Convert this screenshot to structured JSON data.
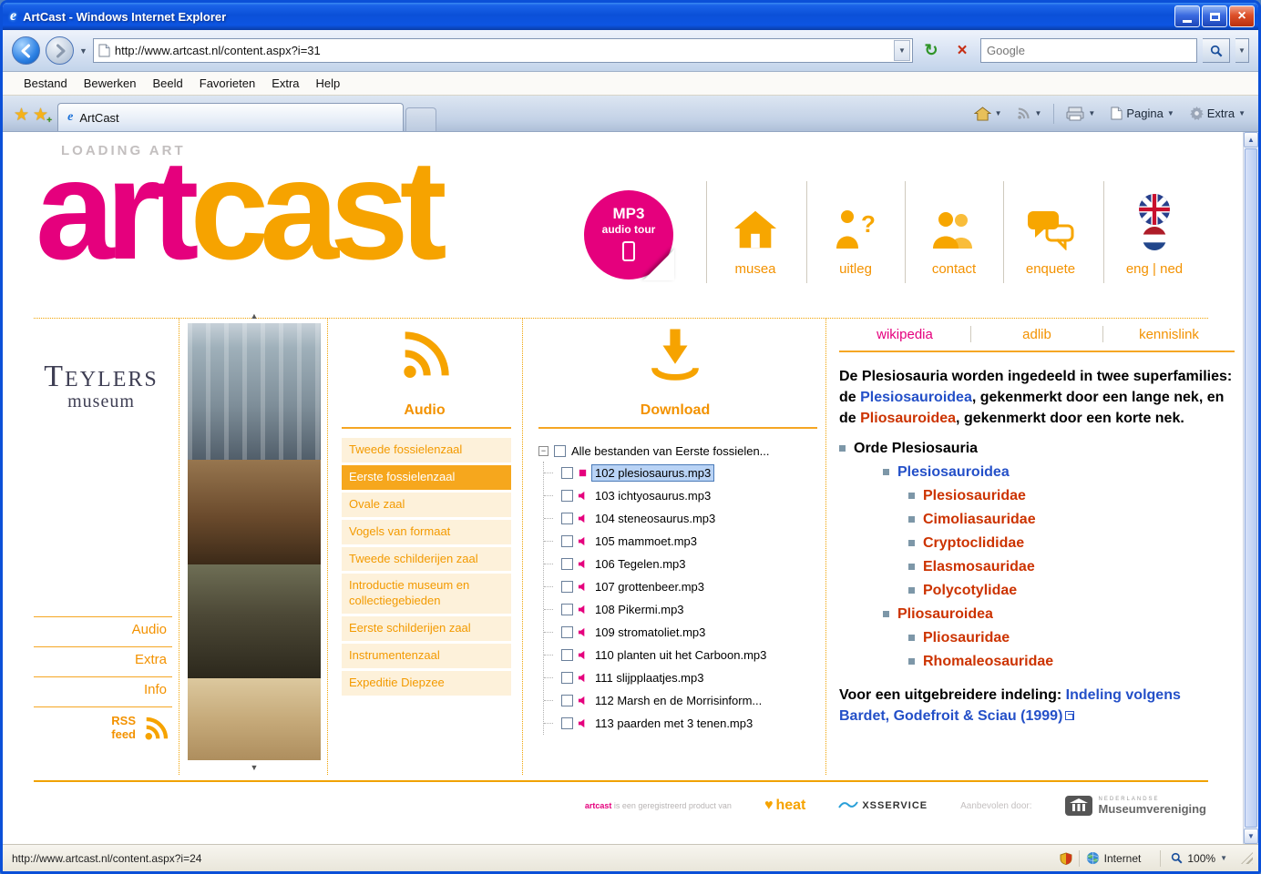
{
  "colors": {
    "brand_pink": "#e5007d",
    "brand_orange": "#f6a300",
    "link_blue": "#2450c8",
    "taxon_red": "#cc3300",
    "xp_titlebar_blue": "#0b50d8"
  },
  "window": {
    "title": "ArtCast - Windows Internet Explorer"
  },
  "address_bar": {
    "url": "http://www.artcast.nl/content.aspx?i=31",
    "search_placeholder": "Google"
  },
  "menu": {
    "items": [
      "Bestand",
      "Bewerken",
      "Beeld",
      "Favorieten",
      "Extra",
      "Help"
    ]
  },
  "tab_bar": {
    "active_tab": "ArtCast",
    "pagina_label": "Pagina",
    "extra_label": "Extra"
  },
  "header": {
    "loading": "LOADING ART",
    "logo_art": "art",
    "logo_cast": "cast",
    "badge_line1": "MP3",
    "badge_line2": "audio tour",
    "nav": [
      {
        "label": "musea"
      },
      {
        "label": "uitleg"
      },
      {
        "label": "contact"
      },
      {
        "label": "enquete"
      }
    ],
    "lang": "eng | ned"
  },
  "sidebar": {
    "museum_name": "Teylers",
    "museum_sub": "museum",
    "links": [
      "Audio",
      "Extra",
      "Info"
    ],
    "rss_line1": "RSS",
    "rss_line2": "feed"
  },
  "audio_panel": {
    "title": "Audio",
    "items": [
      {
        "label": "Tweede fossielenzaal",
        "selected": false
      },
      {
        "label": "Eerste fossielenzaal",
        "selected": true
      },
      {
        "label": "Ovale zaal",
        "selected": false
      },
      {
        "label": "Vogels van formaat",
        "selected": false
      },
      {
        "label": "Tweede schilderijen zaal",
        "selected": false
      },
      {
        "label": "Introductie museum en collectiegebieden",
        "selected": false
      },
      {
        "label": "Eerste schilderijen zaal",
        "selected": false
      },
      {
        "label": "Instrumentenzaal",
        "selected": false
      },
      {
        "label": "Expeditie Diepzee",
        "selected": false
      }
    ]
  },
  "download_panel": {
    "title": "Download",
    "root_label": "Alle bestanden van Eerste fossielen...",
    "files": [
      {
        "label": "102 plesiosaurus.mp3",
        "selected": true
      },
      {
        "label": "103 ichtyosaurus.mp3",
        "selected": false
      },
      {
        "label": "104 steneosaurus.mp3",
        "selected": false
      },
      {
        "label": "105 mammoet.mp3",
        "selected": false
      },
      {
        "label": "106 Tegelen.mp3",
        "selected": false
      },
      {
        "label": "107 grottenbeer.mp3",
        "selected": false
      },
      {
        "label": "108 Pikermi.mp3",
        "selected": false
      },
      {
        "label": "109 stromatoliet.mp3",
        "selected": false
      },
      {
        "label": "110 planten uit het Carboon.mp3",
        "selected": false
      },
      {
        "label": "111 slijpplaatjes.mp3",
        "selected": false
      },
      {
        "label": "112 Marsh en de Morrisinform...",
        "selected": false
      },
      {
        "label": "113 paarden met 3 tenen.mp3",
        "selected": false
      }
    ]
  },
  "wiki_panel": {
    "tabs": [
      "wikipedia",
      "adlib",
      "kennislink"
    ],
    "active_tab": "wikipedia",
    "intro": [
      {
        "text": "De Plesiosauria worden ingedeeld in twee superfamilies: de "
      },
      {
        "text": "Plesiosauroidea"
      },
      {
        "text": ", gekenmerkt door een lange nek, en de "
      },
      {
        "text": "Pliosauroidea"
      },
      {
        "text": ", gekenmerkt door een korte nek."
      }
    ],
    "taxonomy": [
      {
        "label": "Orde Plesiosauria",
        "level": 0
      },
      {
        "label": "Plesiosauroidea",
        "level": 1
      },
      {
        "label": "Plesiosauridae",
        "level": 2
      },
      {
        "label": "Cimoliasauridae",
        "level": 2
      },
      {
        "label": "Cryptoclididae",
        "level": 2
      },
      {
        "label": "Elasmosauridae",
        "level": 2
      },
      {
        "label": "Polycotylidae",
        "level": 2
      },
      {
        "label": "Pliosauroidea",
        "level": 1
      },
      {
        "label": "Pliosauridae",
        "level": 2
      },
      {
        "label": "Rhomaleosauridae",
        "level": 2
      }
    ],
    "more_label": "Voor een uitgebreidere indeling: ",
    "more_link": "Indeling volgens Bardet, Godefroit & Sciau (1999)"
  },
  "footer": {
    "registered_brand": "artcast",
    "registered_text": " is een geregistreerd product van",
    "heat_label": "heat",
    "xsservice_label": "XSSERVICE",
    "recommended_label": "Aanbevolen door:",
    "museum_assoc_top": "NEDERLANDSE",
    "museum_assoc_name": "Museumvereniging"
  },
  "status_bar": {
    "url": "http://www.artcast.nl/content.aspx?i=24",
    "zone": "Internet",
    "zoom": "100%"
  }
}
